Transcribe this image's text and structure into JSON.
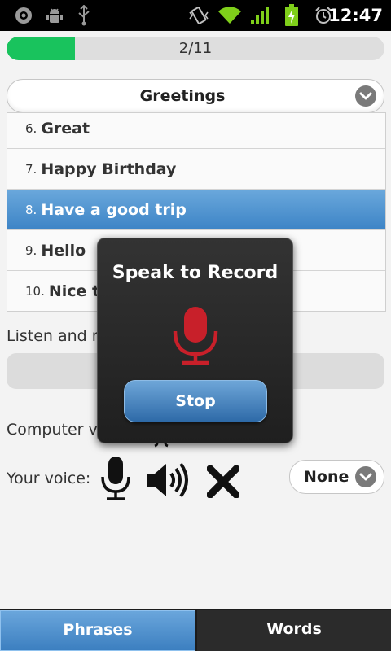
{
  "status_bar": {
    "time": "12:47",
    "icons": [
      "disc-icon",
      "android-debug-icon",
      "usb-icon",
      "vibrate-icon",
      "wifi-icon",
      "signal-icon",
      "battery-charging-icon",
      "alarm-icon"
    ]
  },
  "progress": {
    "text": "2/11",
    "fraction": 0.1818
  },
  "category": {
    "label": "Greetings"
  },
  "phrases": [
    {
      "number": "6.",
      "text": "Great",
      "selected": false
    },
    {
      "number": "7.",
      "text": "Happy Birthday",
      "selected": false
    },
    {
      "number": "8.",
      "text": "Have a good trip",
      "selected": true
    },
    {
      "number": "9.",
      "text": "Hello",
      "selected": false
    },
    {
      "number": "10.",
      "text": "Nice to",
      "selected": false
    }
  ],
  "listen_label": "Listen and re",
  "computer_voice_label": "Computer vo",
  "your_voice": {
    "label": "Your voice:",
    "icons": [
      "microphone-icon",
      "speaker-icon",
      "delete-icon"
    ],
    "dropdown_value": "None"
  },
  "tabs": [
    {
      "label": "Phrases",
      "active": true
    },
    {
      "label": "Words",
      "active": false
    }
  ],
  "record_dialog": {
    "title": "Speak to Record",
    "button": "Stop",
    "mic_color": "#c8202a"
  },
  "colors": {
    "accent_blue": "#3d84c6",
    "progress_green": "#19c35d"
  }
}
